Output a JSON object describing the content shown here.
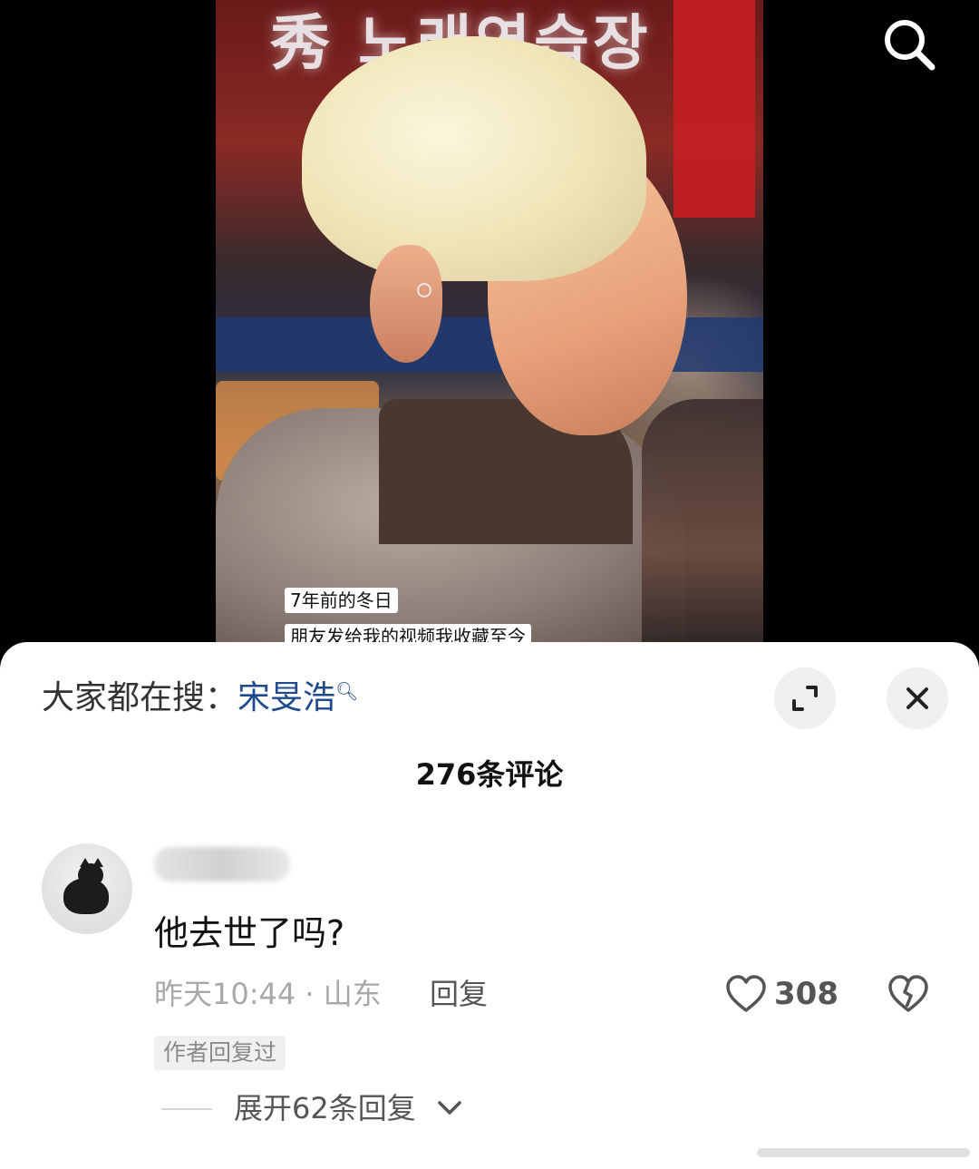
{
  "video": {
    "sign_text": "秀 노래연습장",
    "caption_line1": "7年前的冬日",
    "caption_line2": "朋友发给我的视频我收藏至今"
  },
  "top_bar": {
    "search_icon": "search-icon"
  },
  "sheet": {
    "trending_prefix": "大家都在搜：",
    "trending_keyword": "宋旻浩",
    "comment_count": "276条评论",
    "buttons": {
      "expand_icon": "expand-icon",
      "close_icon": "close-icon"
    }
  },
  "comment": {
    "avatar": "cat-avatar",
    "text": "他去世了吗?",
    "meta": "昨天10:44 · 山东",
    "reply_label": "回复",
    "like_count": "308",
    "author_tag": "作者回复过",
    "expand_replies": "展开62条回复"
  },
  "colors": {
    "keyword": "#1f4a8c",
    "sheet_bg": "#ffffff",
    "meta_text": "#a8a8a8",
    "button_bg": "#efefef"
  }
}
